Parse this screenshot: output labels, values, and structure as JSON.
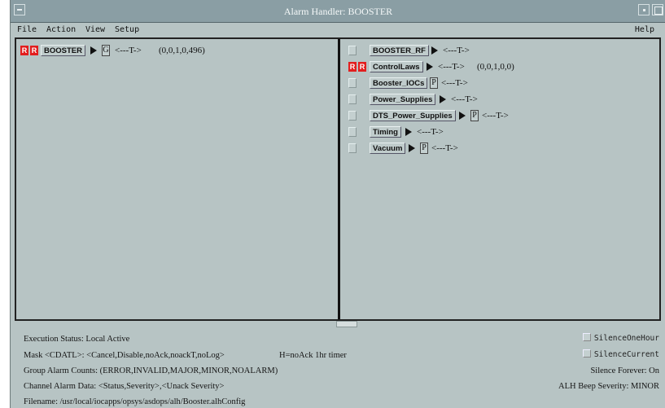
{
  "window": {
    "title": "Alarm Handler: BOOSTER"
  },
  "menu": {
    "file": "File",
    "action": "Action",
    "view": "View",
    "setup": "Setup",
    "help": "Help"
  },
  "left_tree": {
    "r1": "R",
    "r2": "R",
    "name": "BOOSTER",
    "flag": "G",
    "tag": "<---T->",
    "counts": "(0,0,1,0,496)"
  },
  "right_groups": [
    {
      "name": "BOOSTER_RF",
      "flag": "",
      "tag": "<---T->",
      "counts": "",
      "alarm": false
    },
    {
      "name": "ControlLaws",
      "flag": "",
      "tag": "<---T->",
      "counts": "(0,0,1,0,0)",
      "alarm": true,
      "r1": "R",
      "r2": "R"
    },
    {
      "name": "Booster_IOCs",
      "flag": "P",
      "tag": "<---T->",
      "counts": "",
      "alarm": false
    },
    {
      "name": "Power_Supplies",
      "flag": "",
      "tag": "<---T->",
      "counts": "",
      "alarm": false
    },
    {
      "name": "DTS_Power_Supplies",
      "flag": "P",
      "tag": "<---T->",
      "counts": "",
      "alarm": false
    },
    {
      "name": "Timing",
      "flag": "",
      "tag": "<---T->",
      "counts": "",
      "alarm": false
    },
    {
      "name": "Vacuum",
      "flag": "P",
      "tag": "<---T->",
      "counts": "",
      "alarm": false
    }
  ],
  "status": {
    "execution": "Execution Status:  Local Active",
    "mask": "Mask <CDATL>:  <Cancel,Disable,noAck,noackT,noLog>",
    "mask_note": "H=noAck 1hr timer",
    "group_counts": "Group Alarm Counts:  (ERROR,INVALID,MAJOR,MINOR,NOALARM)",
    "channel_data": "Channel Alarm Data:  <Status,Severity>,<Unack Severity>",
    "filename": "Filename:   /usr/local/iocapps/opsys/asdops/alh/Booster.alhConfig",
    "silence_one_hour": "SilenceOneHour",
    "silence_current": "SilenceCurrent",
    "silence_forever": "Silence Forever:   On",
    "beep_severity": "ALH Beep Severity:  MINOR"
  }
}
